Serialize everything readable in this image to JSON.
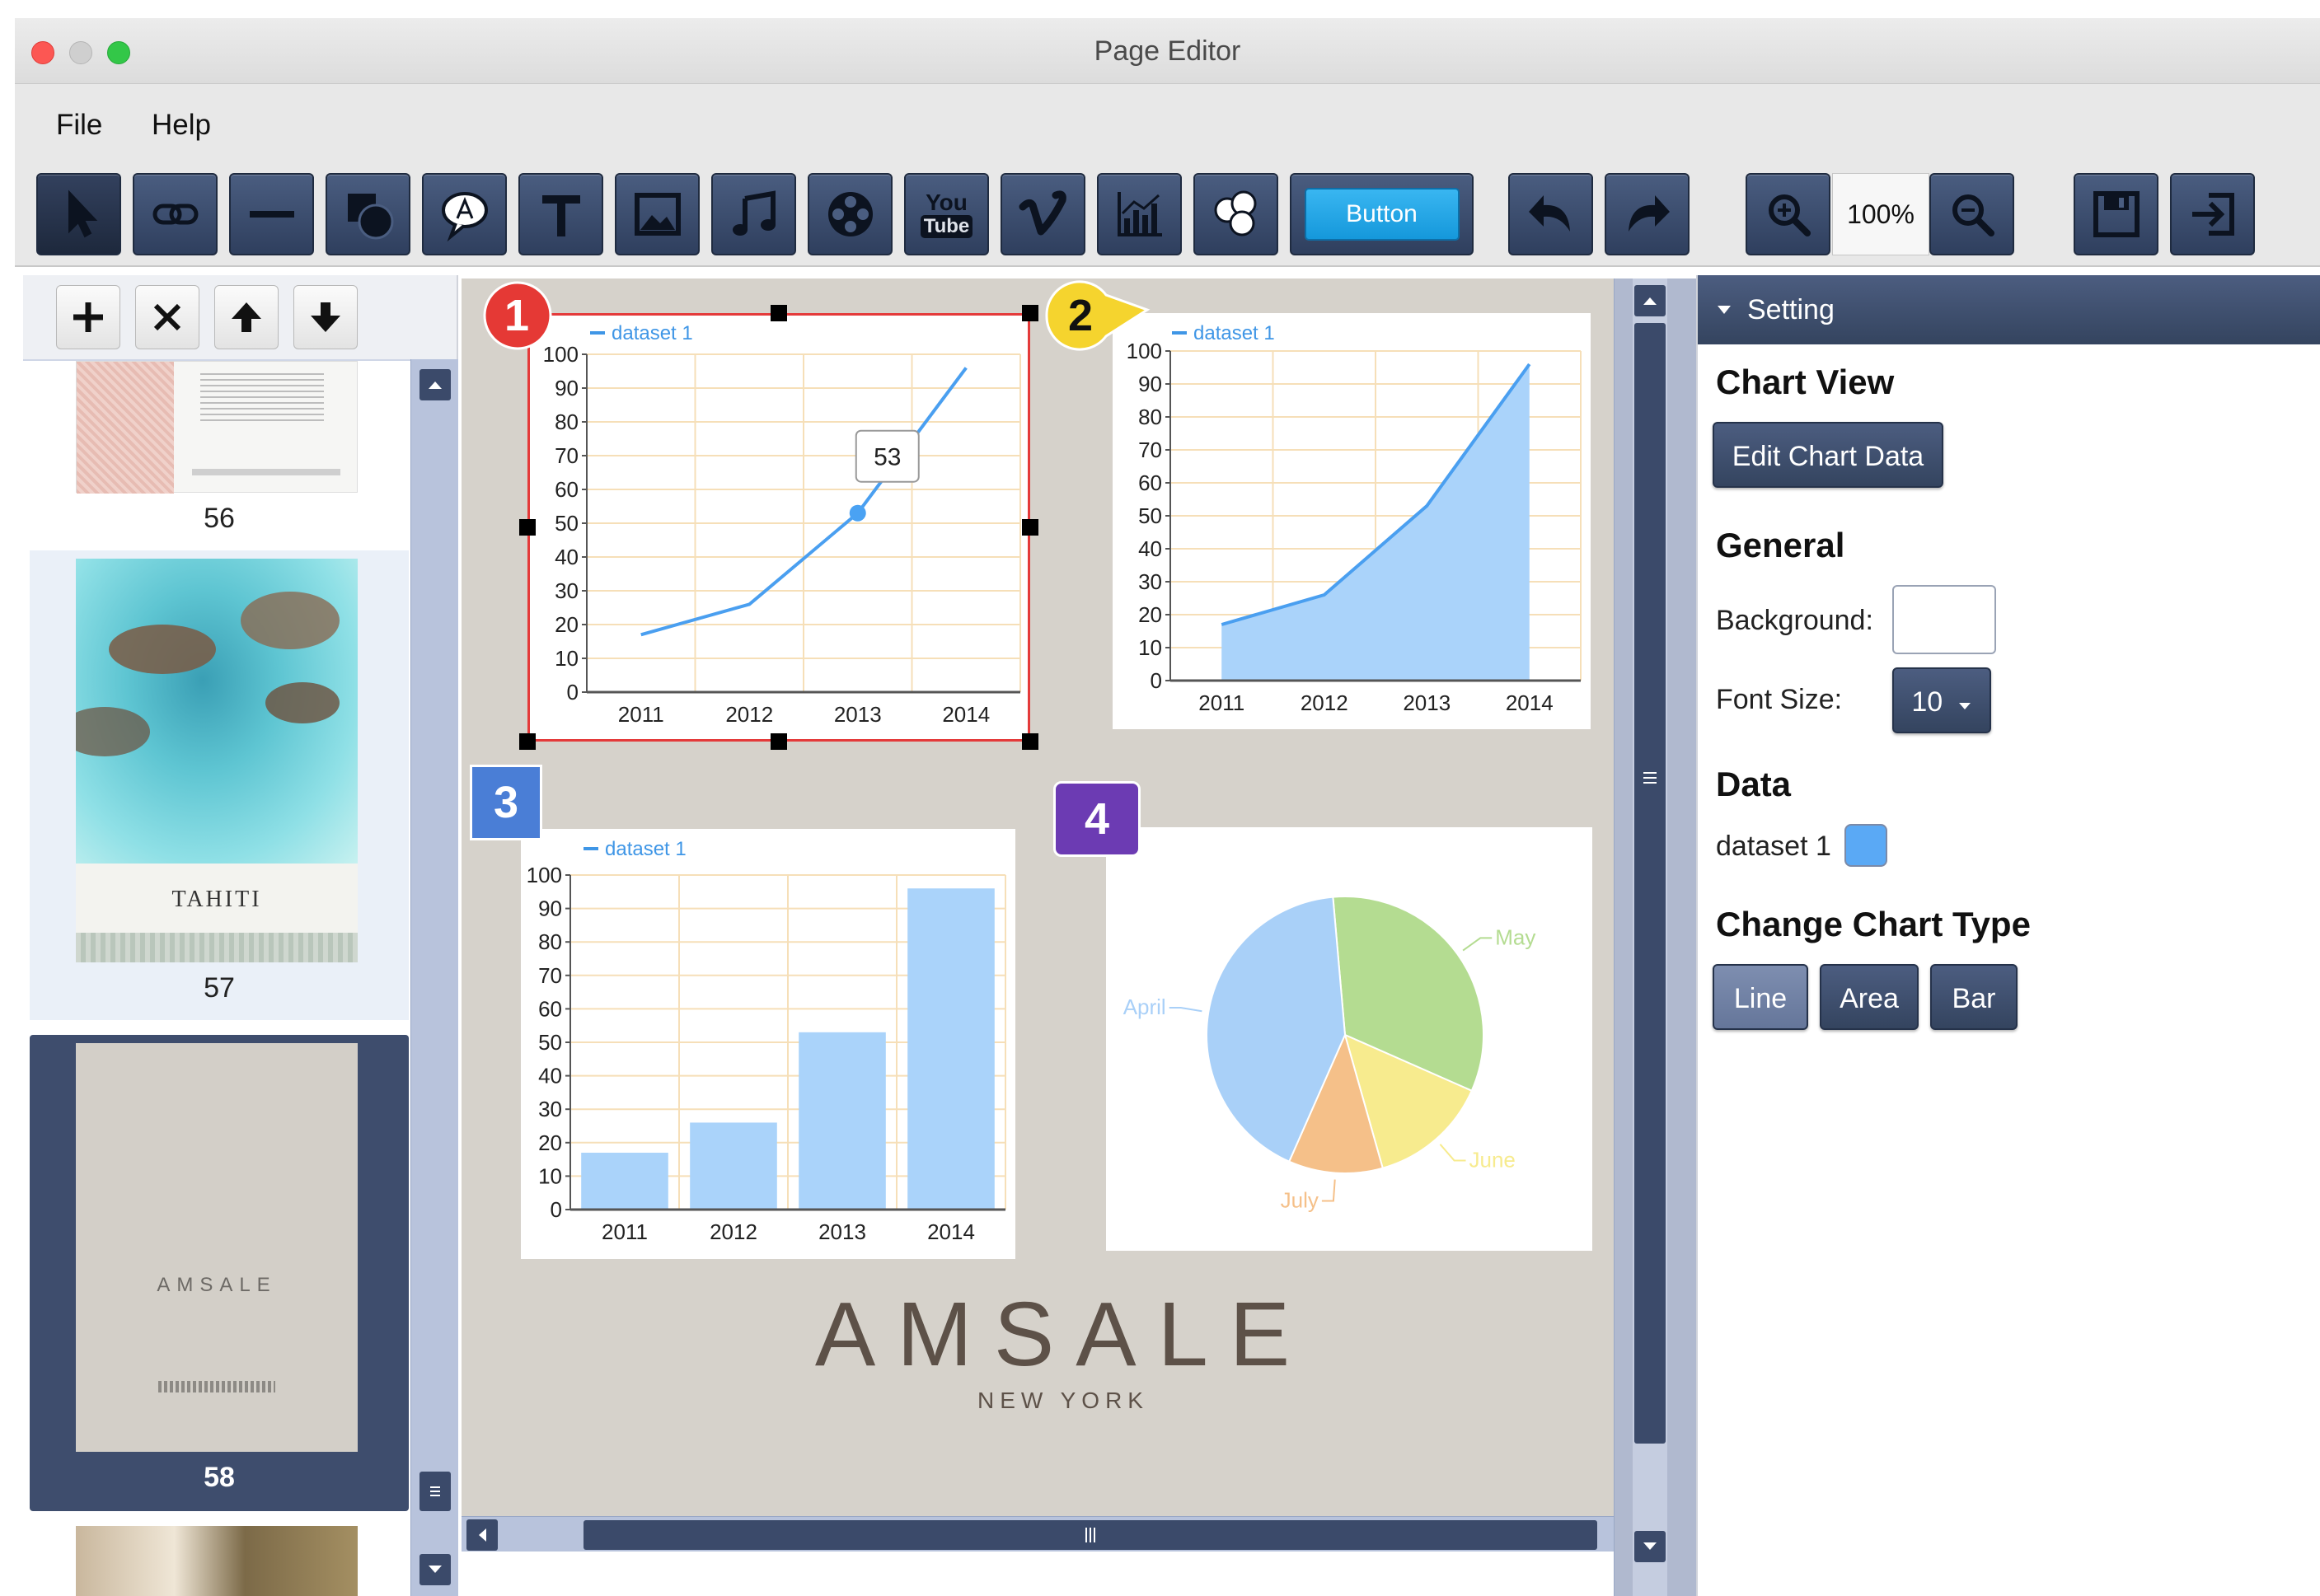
{
  "window": {
    "title": "Page Editor"
  },
  "menu": [
    {
      "label": "File"
    },
    {
      "label": "Help"
    }
  ],
  "toolbar": {
    "button_widget_label": "Button",
    "youtube_you": "You",
    "youtube_tube": "Tube",
    "zoom_level": "100%"
  },
  "pages": {
    "items": [
      {
        "number": "56"
      },
      {
        "number": "57"
      },
      {
        "number": "58"
      }
    ],
    "thumb57_title": "TAHITI",
    "thumb58_title": "AMSALE"
  },
  "markers": [
    "1",
    "2",
    "3",
    "4"
  ],
  "canvas": {
    "logo_main": "AMSALE",
    "logo_sub": "NEW YORK"
  },
  "chart_data": [
    {
      "type": "line",
      "legend": "dataset 1",
      "categories": [
        "2011",
        "2012",
        "2013",
        "2014"
      ],
      "values": [
        17,
        26,
        53,
        96
      ],
      "ylim": [
        0,
        100
      ],
      "yticks": [
        "0",
        "10",
        "20",
        "30",
        "40",
        "50",
        "60",
        "70",
        "80",
        "90",
        "100"
      ],
      "tooltip": "53",
      "grid": true,
      "color": "#4a9ff0"
    },
    {
      "type": "area",
      "legend": "dataset 1",
      "categories": [
        "2011",
        "2012",
        "2013",
        "2014"
      ],
      "values": [
        17,
        26,
        53,
        96
      ],
      "ylim": [
        0,
        100
      ],
      "yticks": [
        "0",
        "10",
        "20",
        "30",
        "40",
        "50",
        "60",
        "70",
        "80",
        "90",
        "100"
      ],
      "grid": true,
      "color": "#4a9ff0",
      "fill": "#aad3fa"
    },
    {
      "type": "bar",
      "legend": "dataset 1",
      "categories": [
        "2011",
        "2012",
        "2013",
        "2014"
      ],
      "values": [
        17,
        26,
        53,
        96
      ],
      "ylim": [
        0,
        100
      ],
      "yticks": [
        "0",
        "10",
        "20",
        "30",
        "40",
        "50",
        "60",
        "70",
        "80",
        "90",
        "100"
      ],
      "grid": true,
      "fill": "#aad3fa"
    },
    {
      "type": "pie",
      "slices": [
        {
          "label": "April",
          "value": 42,
          "color": "#a9d0f8"
        },
        {
          "label": "May",
          "value": 33,
          "color": "#b4dc91"
        },
        {
          "label": "June",
          "value": 14,
          "color": "#f7eb8e"
        },
        {
          "label": "July",
          "value": 11,
          "color": "#f5c089"
        }
      ]
    }
  ],
  "settings": {
    "header": "Setting",
    "chart_view": "Chart View",
    "edit_chart_data": "Edit Chart Data",
    "general": "General",
    "background_label": "Background:",
    "font_size_label": "Font Size:",
    "font_size_value": "10",
    "data_heading": "Data",
    "dataset_label": "dataset 1",
    "dataset_color": "#5aa9f5",
    "change_type": "Change Chart Type",
    "types": [
      {
        "label": "Line"
      },
      {
        "label": "Area"
      },
      {
        "label": "Bar"
      }
    ]
  }
}
